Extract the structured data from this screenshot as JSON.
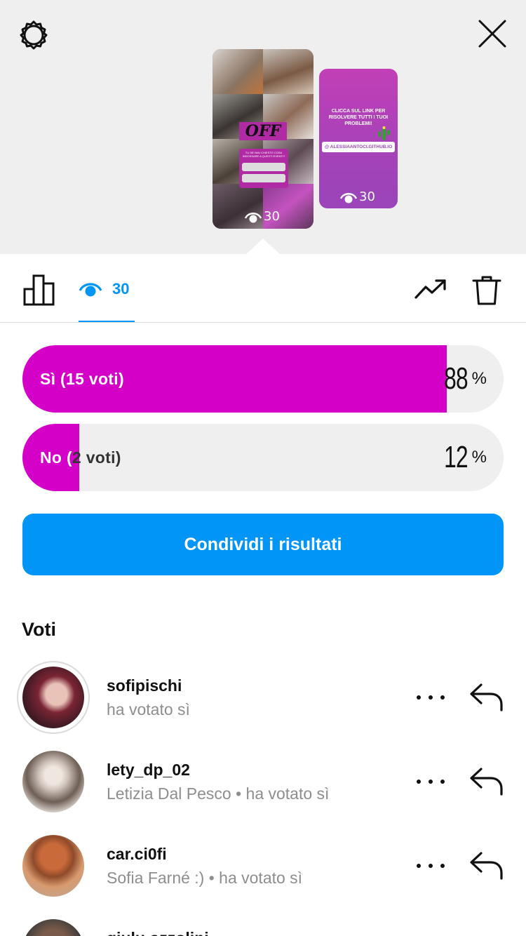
{
  "header": {
    "settings_icon": "gear-icon",
    "close_icon": "close-icon"
  },
  "stories": [
    {
      "views": "30",
      "sticker_text": "OFF",
      "poll_question": "TU SEI MAI CHIESTO COSA INDOSSARE A QUESTI EVENTI?"
    },
    {
      "views": "30",
      "headline": "CLICCA SUL LINK PER RISOLVERE TUTTI I TUOI PROBLEMI!",
      "link": "@ ALESSIAANTOCI.GITHUB.IO"
    }
  ],
  "tabs": {
    "views_count": "30"
  },
  "poll": {
    "options": [
      {
        "label": "Sì (15 voti)",
        "percent": "88",
        "percent_sign": "%",
        "fill_fraction": 0.88
      },
      {
        "label_part1": "No (",
        "label_part2": "2 voti)",
        "percent": "12",
        "percent_sign": "%",
        "fill_fraction": 0.118
      }
    ],
    "accent_color": "#d400c8"
  },
  "share_button": "Condividi i risultati",
  "votes_title": "Voti",
  "voters": [
    {
      "username": "sofipischi",
      "subtitle": "ha votato sì"
    },
    {
      "username": "lety_dp_02",
      "subtitle": "Letizia Dal Pesco • ha votato sì"
    },
    {
      "username": "car.ci0fi",
      "subtitle": "Sofia Farné :) • ha votato sì"
    },
    {
      "username": "giulu.ozzolini",
      "subtitle": ""
    }
  ]
}
